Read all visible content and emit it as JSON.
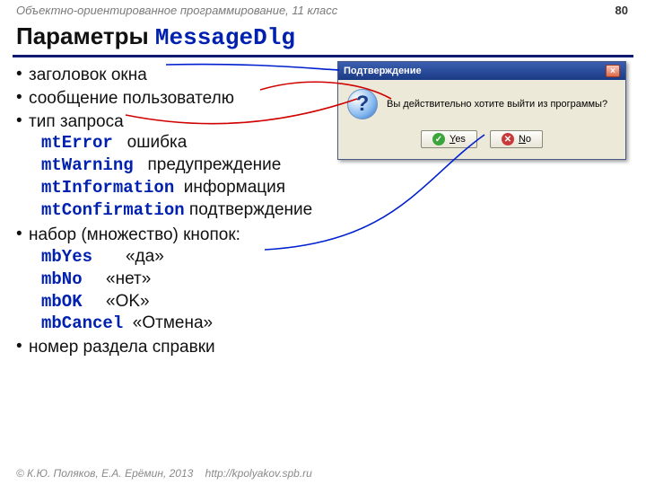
{
  "topbar": "Объектно-ориентированное программирование, 11 класс",
  "page": "80",
  "title_prefix": "Параметры ",
  "title_code": "MessageDlg",
  "bullets": {
    "b1": "заголовок окна",
    "b2": "сообщение пользователю",
    "b3": "тип запроса",
    "b3_items": [
      {
        "c": "mtError",
        "v": "ошибка"
      },
      {
        "c": "mtWarning",
        "v": "предупреждение"
      },
      {
        "c": "mtInformation",
        "v": "информация"
      },
      {
        "c": "mtConfirmation",
        "v": "подтверждение"
      }
    ],
    "b4": "набор (множество) кнопок:",
    "b4_items": [
      {
        "c": "mbYes",
        "v": "«да»"
      },
      {
        "c": "mbNo",
        "v": "«нет»"
      },
      {
        "c": "mbOK",
        "v": "«OK»"
      },
      {
        "c": "mbCancel",
        "v": "«Отмена»"
      }
    ],
    "b5": "номер раздела справки"
  },
  "dialog": {
    "title": "Подтверждение",
    "msg": "Вы действительно хотите выйти из программы?",
    "yes": "Yes",
    "no": "No"
  },
  "footer": {
    "copy": "© К.Ю. Поляков, Е.А. Ерёмин, 2013",
    "url": "http://kpolyakov.spb.ru"
  }
}
